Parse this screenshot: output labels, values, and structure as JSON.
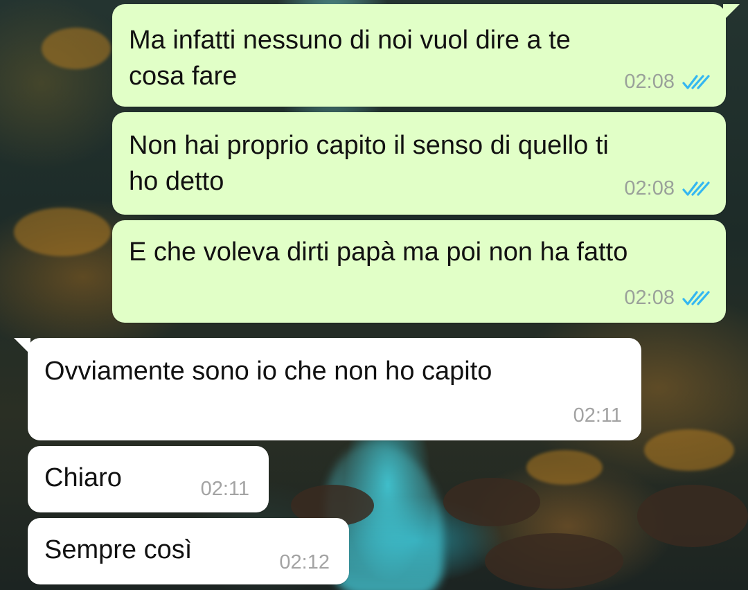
{
  "colors": {
    "outgoing_bubble": "#e1ffc7",
    "incoming_bubble": "#ffffff",
    "read_ticks": "#34b7f1",
    "timestamp": "#9aa19a"
  },
  "messages": [
    {
      "direction": "outgoing",
      "text": "Ma infatti nessuno di noi vuol dire a te\ncosa fare",
      "time": "02:08",
      "status": "read",
      "status_icon": "double-check-icon"
    },
    {
      "direction": "outgoing",
      "text": "Non hai proprio capito il senso di quello ti\nho detto",
      "time": "02:08",
      "status": "read",
      "status_icon": "double-check-icon"
    },
    {
      "direction": "outgoing",
      "text": "E che voleva dirti papà ma poi non ha fatto",
      "time": "02:08",
      "status": "read",
      "status_icon": "double-check-icon"
    },
    {
      "direction": "incoming",
      "text": "Ovviamente sono io che non ho capito",
      "time": "02:11"
    },
    {
      "direction": "incoming",
      "text": "Chiaro",
      "time": "02:11"
    },
    {
      "direction": "incoming",
      "text": "Sempre così",
      "time": "02:12"
    }
  ]
}
